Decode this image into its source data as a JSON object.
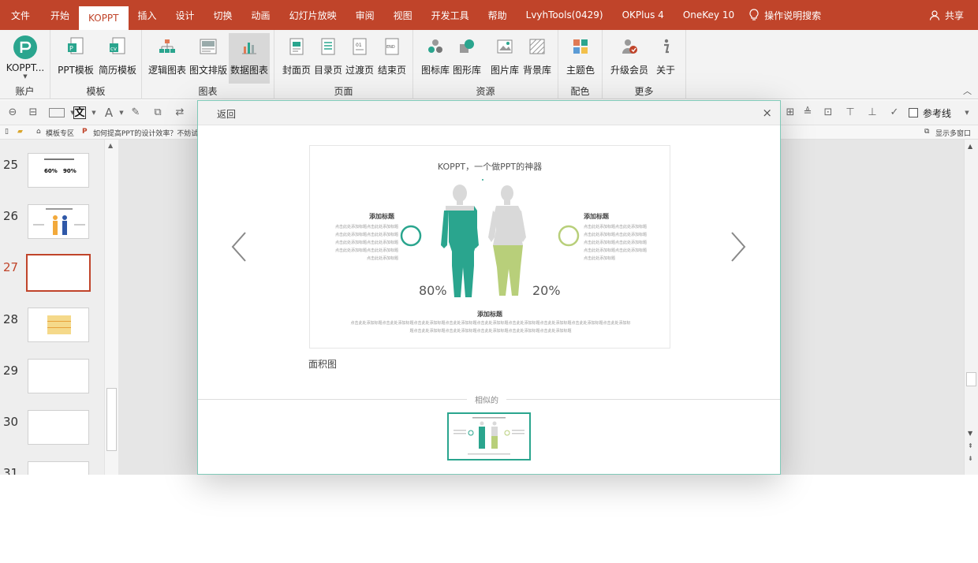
{
  "menu": {
    "tabs": [
      "文件",
      "开始",
      "KOPPT",
      "插入",
      "设计",
      "切换",
      "动画",
      "幻灯片放映",
      "审阅",
      "视图",
      "开发工具",
      "帮助",
      "LvyhTools(0429)",
      "OKPlus 4",
      "OneKey 10"
    ],
    "active_tab": "KOPPT",
    "search_tip": "操作说明搜索",
    "share": "共享"
  },
  "ribbon": {
    "account_button": "KOPPT...",
    "groups": {
      "account": "账户",
      "template": "模板",
      "chart": "图表",
      "page": "页面",
      "resource": "资源",
      "color": "配色",
      "more": "更多"
    },
    "buttons": {
      "ppt_template": "PPT模板",
      "resume_template": "简历模板",
      "logic_chart": "逻辑图表",
      "text_layout": "图文排版",
      "data_chart": "数据图表",
      "cover_page": "封面页",
      "toc_page": "目录页",
      "transition_page": "过渡页",
      "end_page": "结束页",
      "icon_lib": "图标库",
      "shape_lib": "图形库",
      "image_lib": "图片库",
      "bg_lib": "背景库",
      "theme_color": "主题色",
      "upgrade_member": "升级会员",
      "about": "关于"
    }
  },
  "toolbar": {
    "ref_line": "参考线"
  },
  "tabstrip": {
    "template_zone": "模板专区",
    "doc_title": "如何提高PPT的设计效率？不妨试试这",
    "multi_window": "显示多窗口"
  },
  "slides": [
    {
      "num": "25",
      "selected": false
    },
    {
      "num": "26",
      "selected": false
    },
    {
      "num": "27",
      "selected": true
    },
    {
      "num": "28",
      "selected": false
    },
    {
      "num": "29",
      "selected": false
    },
    {
      "num": "30",
      "selected": false
    },
    {
      "num": "31",
      "selected": false
    }
  ],
  "slide25": {
    "left_pct": "60%",
    "right_pct": "90%"
  },
  "dialog": {
    "back": "返回",
    "close": "×",
    "preview": {
      "title": "KOPPT，一个做PPT的神器",
      "left_heading": "添加标题",
      "left_body": "点击此处添加标题点击此处添加标题点击此处添加标题点击此处添加标题点击此处添加标题点击此处添加标题点击此处添加标题点击此处添加标题点击此处添加标题",
      "right_heading": "添加标题",
      "right_body": "点击此处添加标题点击此处添加标题点击此处添加标题点击此处添加标题点击此处添加标题点击此处添加标题点击此处添加标题点击此处添加标题点击此处添加标题",
      "left_pct": "80%",
      "right_pct": "20%",
      "bottom_heading": "添加标题",
      "bottom_body": "点击此处添加标题点击此处添加标题点击此处添加标题点击此处添加标题点击此处添加标题点击此处添加标题点击此处添加标题点击此处添加标题点击此处添加标题点击此处添加标题点击此处添加标题点击此处添加标题点击此处添加标题点击此处添加标题"
    },
    "template_name": "面积图",
    "similar_label": "相似的"
  },
  "colors": {
    "brand_red": "#c0442a",
    "teal": "#2aa58e",
    "lime": "#b8cf7a"
  },
  "icons": [
    "koppt-logo-icon",
    "ppt-template-icon",
    "resume-template-icon",
    "logic-chart-icon",
    "text-layout-icon",
    "data-chart-icon",
    "cover-page-icon",
    "toc-page-icon",
    "transition-page-icon",
    "end-page-icon",
    "icon-lib-icon",
    "shape-lib-icon",
    "image-lib-icon",
    "bg-lib-icon",
    "theme-color-icon",
    "upgrade-member-icon",
    "about-icon",
    "lightbulb-icon",
    "share-person-icon",
    "close-icon",
    "chevron-left-icon",
    "chevron-right-icon"
  ]
}
